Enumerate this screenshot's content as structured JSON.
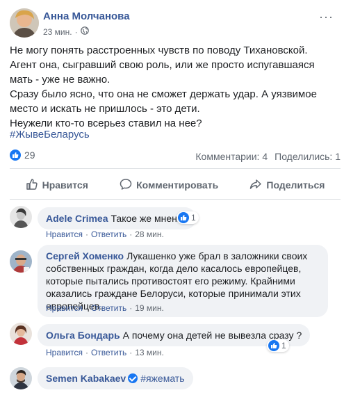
{
  "post": {
    "author": "Анна Молчанова",
    "time": "23 мин.",
    "dot": "·",
    "text_lines": [
      "Не могу понять расстроенных чувств по поводу Тихановской. Агент она, сыгравший свою роль, или же просто испугавшаяся мать - уже не важно.",
      "Сразу было ясно, что она не сможет держать удар. А уязвимое место и искать не пришлось - это дети.",
      "Неужели кто-то всерьез ставил на нее?"
    ],
    "hashtag": "#ЖывеБеларусь",
    "like_count": "29",
    "comments_count": "Комментарии: 4",
    "shares_count": "Поделились: 1"
  },
  "actions": {
    "like": "Нравится",
    "comment": "Комментировать",
    "share": "Поделиться"
  },
  "comment_meta": {
    "like": "Нравится",
    "reply": "Ответить",
    "sep": "·"
  },
  "comments": [
    {
      "name": "Adele Crimea",
      "text": "Такое же мнение",
      "time": "28 мин.",
      "reactions": "1"
    },
    {
      "name": "Сергей Хоменко",
      "text": "Лукашенко уже брал в заложники своих собственных граждан, когда дело касалось европейцев, которые пытались противостоят его режиму. Крайними оказались граждане Белоруси, которые принимали этих европейцев.",
      "time": "19 мин."
    },
    {
      "name": "Ольга Бондарь",
      "text": "А почему она детей не вывезла сразу ?",
      "time": "13 мин.",
      "reactions": "1"
    },
    {
      "name": "Semen Kabakaev",
      "text": "#яжемать"
    }
  ],
  "colors": {
    "link": "#385898",
    "accent": "#1877f2",
    "muted": "#606770",
    "bubble": "#f0f2f5"
  }
}
